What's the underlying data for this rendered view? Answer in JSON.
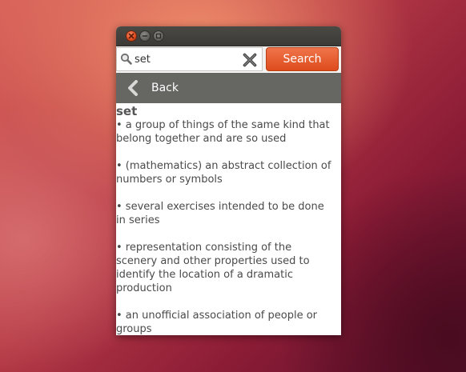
{
  "window": {
    "buttons": [
      "close",
      "minimize",
      "maximize"
    ]
  },
  "search": {
    "value": "set",
    "button_label": "Search",
    "search_icon": "magnifier-icon",
    "clear_icon": "clear-x-icon"
  },
  "nav": {
    "back_label": "Back",
    "back_icon": "chevron-left-icon"
  },
  "entry": {
    "word": "set",
    "definitions": [
      "• a group of things of the same kind that belong together and are so used",
      "• (mathematics) an abstract collection of numbers or symbols",
      "• several exercises intended to be done in series",
      "• representation consisting of the scenery and other properties used to identify the location of a dramatic production",
      "• an unofficial association of people or groups"
    ]
  },
  "colors": {
    "accent": "#dd4c1d",
    "navbar": "#666663",
    "titlebar": "#3b3a36"
  }
}
